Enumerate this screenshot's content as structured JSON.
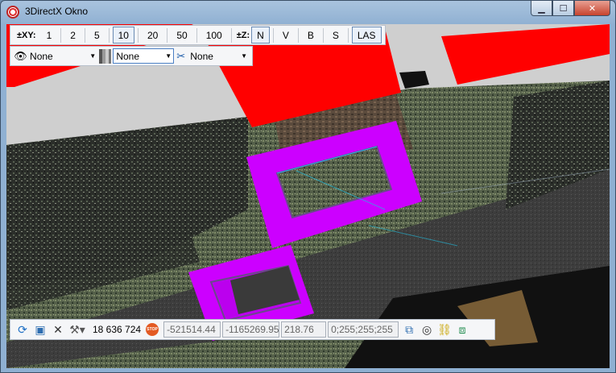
{
  "window": {
    "title": "3DirectX Okno",
    "minimize": "▁",
    "maximize": "☐",
    "close": "✕"
  },
  "xy_toolbar": {
    "label": "±XY:",
    "steps": [
      "1",
      "2",
      "5",
      "10",
      "20",
      "50",
      "100"
    ],
    "selected_step": "10",
    "z_label": "±Z:",
    "views": [
      "N",
      "V",
      "B",
      "S"
    ],
    "selected_view": "N",
    "las_label": "LAS"
  },
  "selector_toolbar": {
    "visibility_value": "None",
    "color_value": "None",
    "filter_value": "None"
  },
  "statusbar": {
    "point_count": "18 636 724",
    "stop_label": "STOP",
    "x_value": "-521514.44",
    "y_value": "-1165269.95",
    "z_value": "218.76",
    "color_value": "0;255;255;255"
  },
  "colors": {
    "building_roof": "#ff0000",
    "selection_box": "#cc00ff",
    "window_frame": "#8fb0d2"
  }
}
